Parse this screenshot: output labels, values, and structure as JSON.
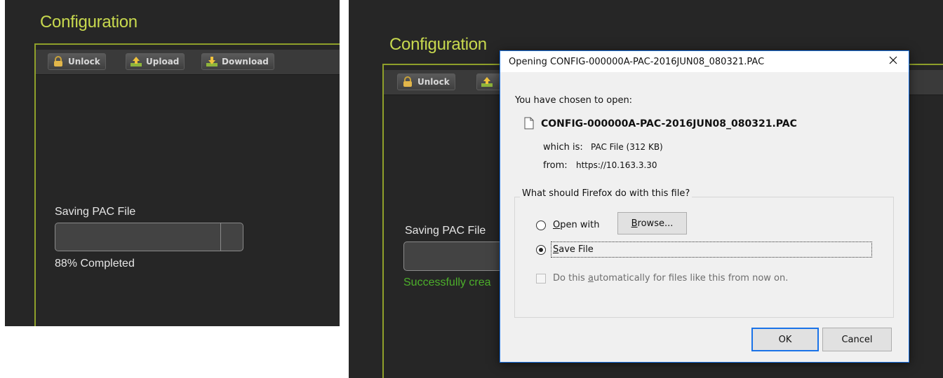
{
  "left_panel": {
    "title": "Configuration",
    "toolbar": {
      "unlock_label": "Unlock",
      "upload_label": "Upload",
      "download_label": "Download"
    },
    "saving_label": "Saving PAC File",
    "progress_percent": 88,
    "status_text": "88% Completed"
  },
  "right_panel": {
    "title": "Configuration",
    "toolbar": {
      "unlock_label": "Unlock"
    },
    "saving_label": "Saving PAC File",
    "status_text": "Successfully crea"
  },
  "dialog": {
    "title": "Opening CONFIG-000000A-PAC-2016JUN08_080321.PAC",
    "intro": "You have chosen to open:",
    "filename": "CONFIG-000000A-PAC-2016JUN08_080321.PAC",
    "which_is_label": "which is:",
    "which_is_value": "PAC File (312 KB)",
    "from_label": "from:",
    "from_value": "https://10.163.3.30",
    "question": "What should Firefox do with this file?",
    "open_with_label": "Open with",
    "browse_label": "Browse...",
    "save_file_label": "Save File",
    "auto_label": "Do this automatically for files like this from now on.",
    "ok_label": "OK",
    "cancel_label": "Cancel",
    "selected_option": "save-file"
  },
  "colors": {
    "panel_bg": "#262626",
    "accent_green": "#c8d94e",
    "frame_green": "#8fa02a",
    "success_green": "#4caf2a",
    "dialog_border": "#1a73e8"
  }
}
